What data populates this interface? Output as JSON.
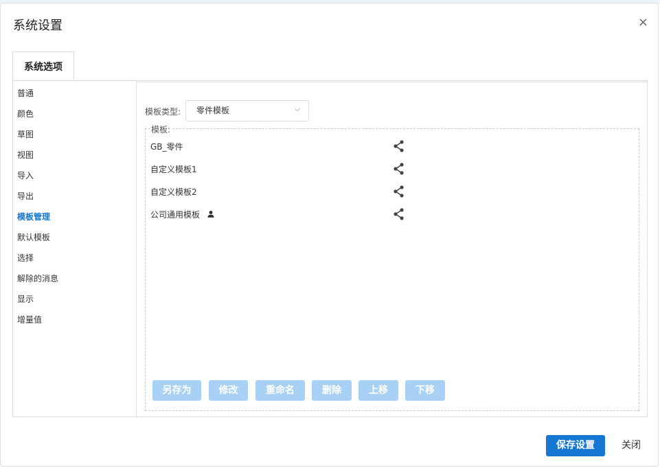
{
  "dialog": {
    "title": "系统设置",
    "close_glyph": "×"
  },
  "tabs": [
    {
      "label": "系统选项",
      "active": true
    }
  ],
  "sidebar": {
    "items": [
      {
        "label": "普通"
      },
      {
        "label": "颜色"
      },
      {
        "label": "草图"
      },
      {
        "label": "视图"
      },
      {
        "label": "导入"
      },
      {
        "label": "导出"
      },
      {
        "label": "模板管理",
        "active": true
      },
      {
        "label": "默认模板"
      },
      {
        "label": "选择"
      },
      {
        "label": "解除的消息"
      },
      {
        "label": "显示"
      },
      {
        "label": "增量值"
      }
    ]
  },
  "template_type": {
    "label": "模板类型:",
    "selected": "零件模板"
  },
  "templates": {
    "legend": "模板:",
    "items": [
      {
        "name": "GB_零件",
        "personal": false,
        "icon": "share-icon"
      },
      {
        "name": "自定义模板1",
        "personal": false,
        "icon": "share-icon"
      },
      {
        "name": "自定义模板2",
        "personal": false,
        "icon": "share-icon"
      },
      {
        "name": "公司通用模板",
        "personal": true,
        "icon": "share-icon"
      }
    ]
  },
  "actions": {
    "save_as": "另存为",
    "modify": "修改",
    "rename": "重命名",
    "delete": "删除",
    "move_up": "上移",
    "move_down": "下移"
  },
  "footer": {
    "save_label": "保存设置",
    "close_label": "关闭"
  },
  "colors": {
    "accent": "#1677d2",
    "disabled_button": "#a9d1f6",
    "border": "#dcdcdc"
  }
}
